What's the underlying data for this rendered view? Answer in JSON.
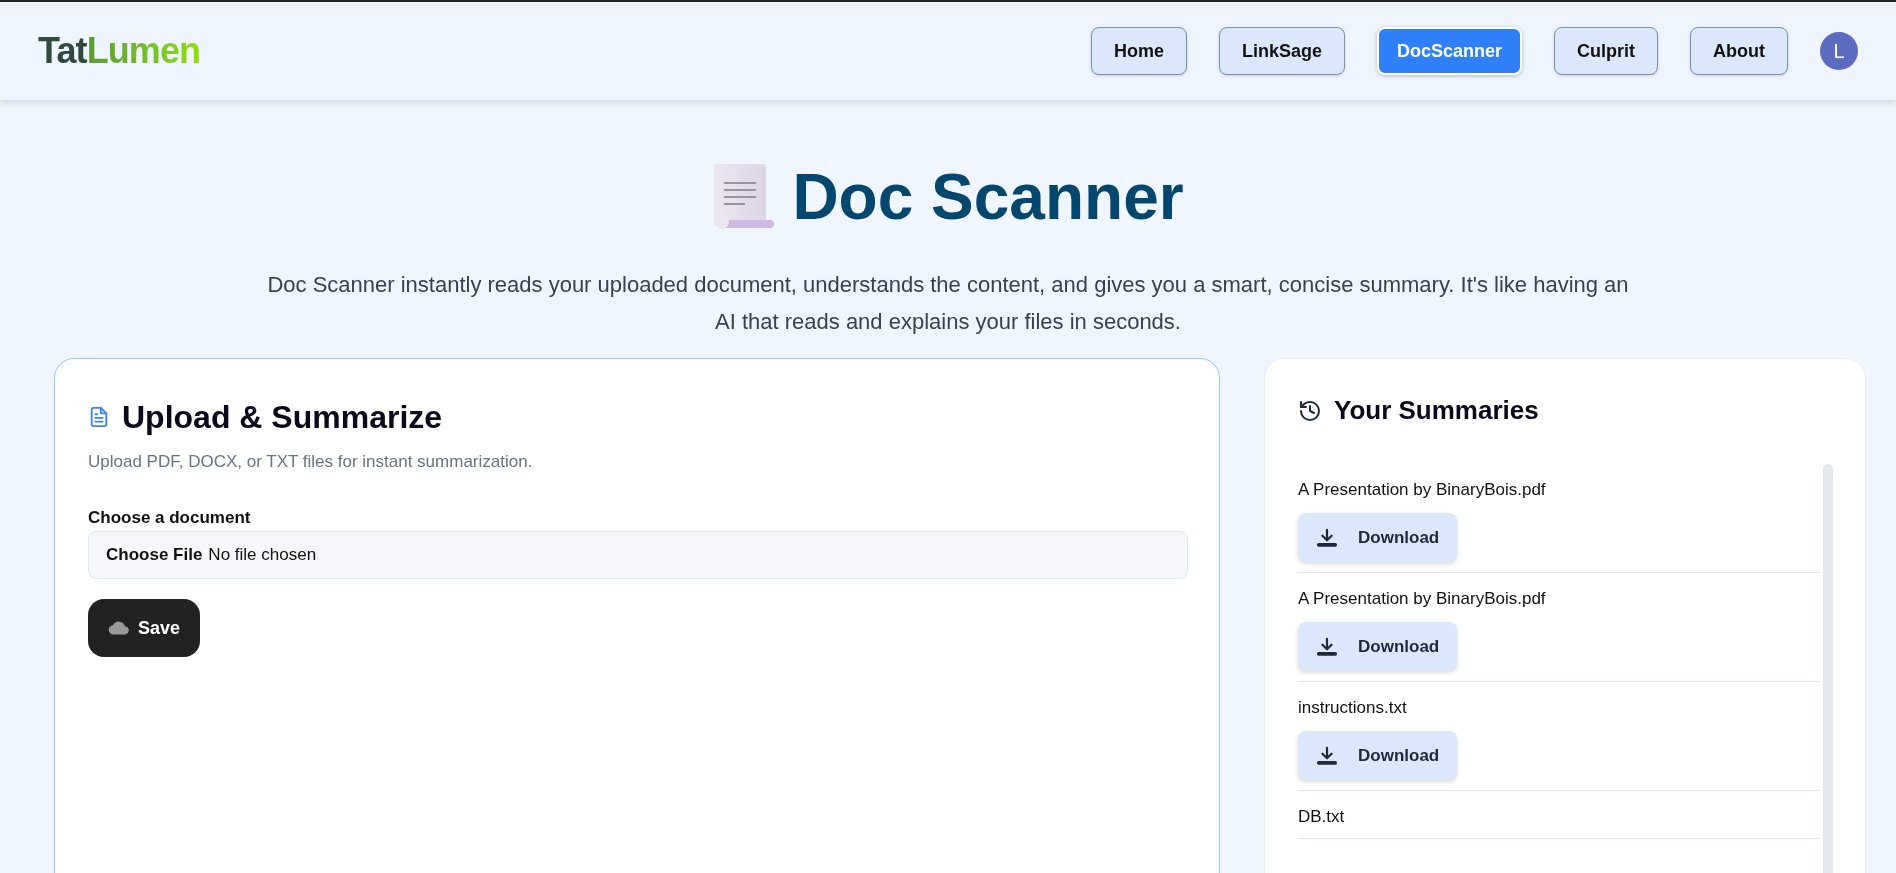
{
  "header": {
    "logo": [
      "Tat",
      "Lumen"
    ],
    "nav": [
      {
        "label": "Home",
        "selected": false
      },
      {
        "label": "LinkSage",
        "selected": false
      },
      {
        "label": "DocScanner",
        "selected": true
      },
      {
        "label": "Culprit",
        "selected": false
      },
      {
        "label": "About",
        "selected": false
      }
    ],
    "avatar": "L"
  },
  "hero": {
    "title": "Doc Scanner",
    "description": "Doc Scanner instantly reads your uploaded document, understands the content, and gives you a smart, concise summary. It's like having an AI that reads and explains your files in seconds."
  },
  "upload_card": {
    "title": "Upload & Summarize",
    "subtitle": "Upload PDF, DOCX, or TXT files for instant summarization.",
    "field_label": "Choose a document",
    "file_button": "Choose File",
    "file_status": "No file chosen",
    "save_button": "Save"
  },
  "summaries_card": {
    "title": "Your Summaries",
    "items": [
      {
        "name": "A Presentation by BinaryBois.pdf",
        "button": "Download"
      },
      {
        "name": "A Presentation by BinaryBois.pdf",
        "button": "Download"
      },
      {
        "name": "instructions.txt",
        "button": "Download"
      },
      {
        "name": "DB.txt"
      }
    ]
  }
}
